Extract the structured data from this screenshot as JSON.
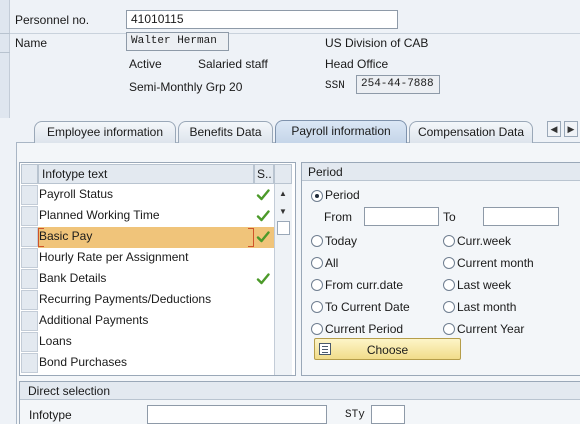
{
  "header": {
    "personnel_label": "Personnel no.",
    "personnel_value": "41010115",
    "name_label": "Name",
    "name_value": "Walter Herman",
    "status": "Active",
    "emp_group": "Salaried staff",
    "payroll_area": "Semi-Monthly Grp 20",
    "division": "US Division of CAB",
    "location": "Head Office",
    "ssn_label": "SSN",
    "ssn_value": "254-44-7888"
  },
  "tabs": {
    "employee": "Employee information",
    "benefits": "Benefits Data",
    "payroll": "Payroll information",
    "compensation": "Compensation Data",
    "active": "payroll"
  },
  "infotype_table": {
    "col_text": "Infotype text",
    "col_status": "S..",
    "rows": [
      {
        "label": "Payroll Status",
        "checked": true
      },
      {
        "label": "Planned Working Time",
        "checked": true
      },
      {
        "label": "Basic Pay",
        "checked": true,
        "selected": true
      },
      {
        "label": "Hourly Rate per Assignment",
        "checked": false
      },
      {
        "label": "Bank Details",
        "checked": true
      },
      {
        "label": "Recurring Payments/Deductions",
        "checked": false
      },
      {
        "label": "Additional Payments",
        "checked": false
      },
      {
        "label": "Loans",
        "checked": false
      },
      {
        "label": "Bond Purchases",
        "checked": false
      }
    ]
  },
  "period": {
    "title": "Period",
    "period_option": "Period",
    "from_label": "From",
    "to_label": "To",
    "from_value": "",
    "to_value": "",
    "options_left": [
      "Today",
      "All",
      "From curr.date",
      "To Current Date",
      "Current Period"
    ],
    "options_right": [
      "Curr.week",
      "Current month",
      "Last week",
      "Last month",
      "Current Year"
    ],
    "choose_label": "Choose"
  },
  "direct_selection": {
    "title": "Direct selection",
    "infotype_label": "Infotype",
    "infotype_value": "",
    "sty_label": "STy",
    "sty_value": ""
  },
  "colors": {
    "selection": "#f0c47a",
    "check_green": "#4c9a2a",
    "choose_button": "#f6e9a8"
  }
}
